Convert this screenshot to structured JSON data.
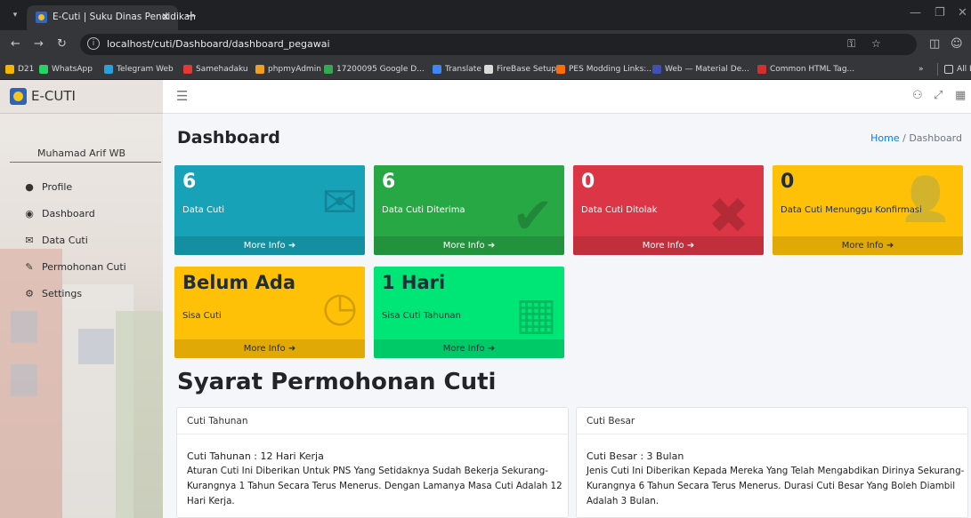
{
  "browser": {
    "tab_title": "E-Cuti | Suku Dinas Pendidikan",
    "url": "localhost/cuti/Dashboard/dashboard_pegawai",
    "bookmarks": [
      {
        "label": "D21",
        "color": "#f4b400"
      },
      {
        "label": "WhatsApp",
        "color": "#25d366"
      },
      {
        "label": "Telegram Web",
        "color": "#2aa1da"
      },
      {
        "label": "Samehadaku",
        "color": "#e53935"
      },
      {
        "label": "phpmyAdmin",
        "color": "#f0a020"
      },
      {
        "label": "17200095 Google D...",
        "color": "#34a853"
      },
      {
        "label": "Translate",
        "color": "#4285f4"
      },
      {
        "label": "FireBase Setup",
        "color": "#202124"
      },
      {
        "label": "PES Modding Links:...",
        "color": "#ff6d00"
      },
      {
        "label": "Web — Material De...",
        "color": "#3f51b5"
      },
      {
        "label": "Common HTML Tag...",
        "color": "#d32f2f"
      }
    ],
    "all_bookmarks": "All Bookmarks"
  },
  "brand": {
    "name": "E-CUTI"
  },
  "user": {
    "name": "Muhamad Arif WB"
  },
  "menu": [
    {
      "label": "Profile",
      "icon": "user-icon"
    },
    {
      "label": "Dashboard",
      "icon": "dashboard-icon"
    },
    {
      "label": "Data Cuti",
      "icon": "envelope-icon"
    },
    {
      "label": "Permohonan Cuti",
      "icon": "edit-icon"
    },
    {
      "label": "Settings",
      "icon": "gear-icon"
    }
  ],
  "page": {
    "title": "Dashboard",
    "breadcrumb": {
      "home": "Home",
      "sep": "/",
      "current": "Dashboard"
    }
  },
  "boxes": [
    {
      "value": "6",
      "label": "Data Cuti",
      "more": "More Info ➜",
      "color": "#17a2b8",
      "icon": "envelope-icon"
    },
    {
      "value": "6",
      "label": "Data Cuti Diterima",
      "more": "More Info ➜",
      "color": "#28a745",
      "icon": "check-icon"
    },
    {
      "value": "0",
      "label": "Data Cuti Ditolak",
      "more": "More Info ➜",
      "color": "#dc3545",
      "icon": "times-icon"
    },
    {
      "value": "0",
      "label": "Data Cuti Menunggu Konfirmasi",
      "more": "More Info ➜",
      "color": "#ffc107",
      "icon": "user-plus-icon"
    },
    {
      "value": "Belum Ada",
      "label": "Sisa Cuti",
      "more": "More Info ➜",
      "color": "#ffc107",
      "icon": "clock-icon"
    },
    {
      "value": "1 Hari",
      "label": "Sisa Cuti Tahunan",
      "more": "More Info ➜",
      "color": "#00e676",
      "icon": "calendar-icon"
    }
  ],
  "section": {
    "title": "Syarat Permohonan Cuti"
  },
  "cards": [
    {
      "header": "Cuti Tahunan",
      "subtitle": "Cuti Tahunan : 12 Hari Kerja",
      "body": "Aturan Cuti Ini Diberikan Untuk PNS Yang Setidaknya Sudah Bekerja Sekurang-Kurangnya 1 Tahun Secara Terus Menerus. Dengan Lamanya Masa Cuti Adalah 12 Hari Kerja."
    },
    {
      "header": "Cuti Besar",
      "subtitle": "Cuti Besar : 3 Bulan",
      "body": "Jenis Cuti Ini Diberikan Kepada Mereka Yang Telah Mengabdikan Dirinya Sekurang-Kurangnya 6 Tahun Secara Terus Menerus. Durasi Cuti Besar Yang Boleh Diambil Adalah 3 Bulan."
    }
  ]
}
